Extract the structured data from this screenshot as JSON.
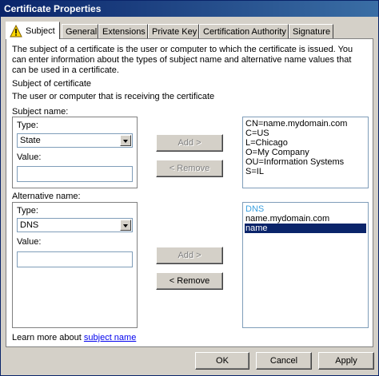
{
  "window": {
    "title": "Certificate Properties"
  },
  "tabs": [
    {
      "label": "Subject"
    },
    {
      "label": "General"
    },
    {
      "label": "Extensions"
    },
    {
      "label": "Private Key"
    },
    {
      "label": "Certification Authority"
    },
    {
      "label": "Signature"
    }
  ],
  "subject_tab": {
    "intro": "The subject of a certificate is the user or computer to which the certificate is issued. You can enter information about the types of subject name and alternative name values that can be used in a certificate.",
    "section_title": "Subject of certificate",
    "section_desc": "The user or computer that is receiving the certificate",
    "subject_name_label": "Subject name:",
    "subject_type_label": "Type:",
    "subject_type_value": "State",
    "subject_value_label": "Value:",
    "subject_value": "",
    "add_label": "Add >",
    "remove_label": "< Remove",
    "subject_list": [
      "CN=name.mydomain.com",
      "C=US",
      "L=Chicago",
      "O=My Company",
      "OU=Information Systems",
      "S=IL"
    ],
    "alt_name_label": "Alternative name:",
    "alt_type_label": "Type:",
    "alt_type_value": "DNS",
    "alt_value_label": "Value:",
    "alt_value": "",
    "alt_list": [
      "DNS",
      "name.mydomain.com",
      "name"
    ],
    "learn_more_prefix": "Learn more about ",
    "learn_more_link": "subject name"
  },
  "footer": {
    "ok": "OK",
    "cancel": "Cancel",
    "apply": "Apply"
  },
  "colors": {
    "title_start": "#0a246a",
    "selection": "#0a246a",
    "list_header": "#3aa0e0"
  }
}
